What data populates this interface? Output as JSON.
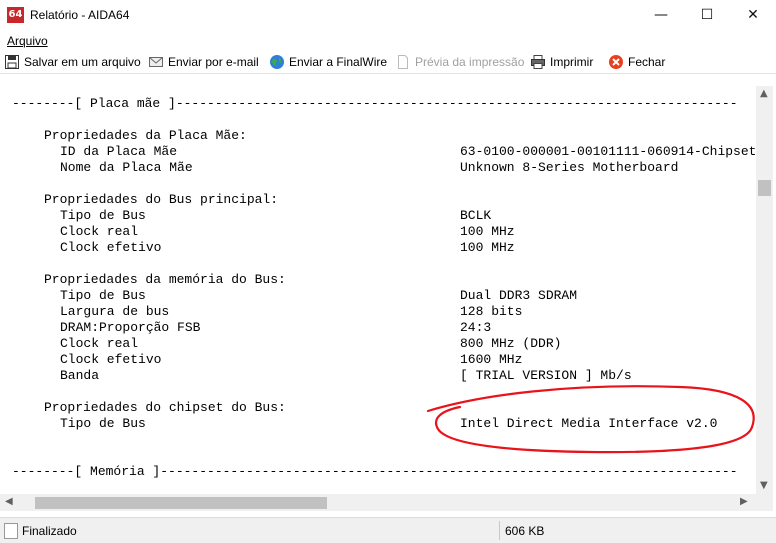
{
  "window": {
    "app_icon": "64",
    "title": "Relatório - AIDA64",
    "controls": {
      "minimize": "—",
      "maximize": "☐",
      "close": "✕"
    }
  },
  "menu": {
    "arquivo": "Arquivo"
  },
  "toolbar": {
    "save": "Salvar em um arquivo",
    "email": "Enviar por e-mail",
    "finalwire": "Enviar a FinalWire",
    "preview": "Prévia da impressão",
    "print": "Imprimir",
    "close": "Fechar"
  },
  "report": {
    "section_motherboard": "--------[ Placa mãe ]------------------------------------------------------------------------",
    "mb_props": {
      "title": "Propriedades da Placa Mãe:",
      "rows": [
        {
          "label": "ID da Placa Mãe",
          "value": "63-0100-000001-00101111-060914-Chipset"
        },
        {
          "label": "Nome da Placa Mãe",
          "value": "Unknown 8-Series Motherboard"
        }
      ]
    },
    "bus_props": {
      "title": "Propriedades do Bus principal:",
      "rows": [
        {
          "label": "Tipo de Bus",
          "value": "BCLK"
        },
        {
          "label": "Clock real",
          "value": "100 MHz"
        },
        {
          "label": "Clock efetivo",
          "value": "100 MHz"
        }
      ]
    },
    "mem_props": {
      "title": "Propriedades da memória do Bus:",
      "rows": [
        {
          "label": "Tipo de Bus",
          "value": "Dual DDR3 SDRAM"
        },
        {
          "label": "Largura de bus",
          "value": "128 bits"
        },
        {
          "label": "DRAM:Proporção FSB",
          "value": "24:3"
        },
        {
          "label": "Clock real",
          "value": "800 MHz (DDR)"
        },
        {
          "label": "Clock efetivo",
          "value": "1600 MHz"
        },
        {
          "label": "Banda",
          "value": "[ TRIAL VERSION ] Mb/s"
        }
      ]
    },
    "chipset_props": {
      "title": "Propriedades do chipset do Bus:",
      "rows": [
        {
          "label": "Tipo de Bus",
          "value": "Intel Direct Media Interface v2.0"
        }
      ]
    },
    "section_memory": "--------[ Memória ]--------------------------------------------------------------------------"
  },
  "status": {
    "state": "Finalizado",
    "size": "606 KB"
  },
  "colors": {
    "annotation": "#e8141b",
    "fechar_icon": "#e8401c"
  }
}
